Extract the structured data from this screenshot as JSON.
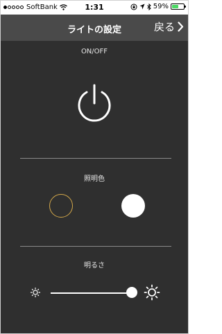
{
  "status": {
    "carrier": "SoftBank",
    "time": "1:31",
    "battery_text": "59%",
    "battery_level": 0.59,
    "signal_filled": 1,
    "signal_total": 5
  },
  "nav": {
    "title": "ライトの設定",
    "back_label": "戻る"
  },
  "power": {
    "label": "ON/OFF"
  },
  "color": {
    "label": "照明色",
    "warm_color": "#d4a84a",
    "cool_color": "#ffffff"
  },
  "brightness": {
    "label": "明るさ",
    "level": 0.94
  }
}
